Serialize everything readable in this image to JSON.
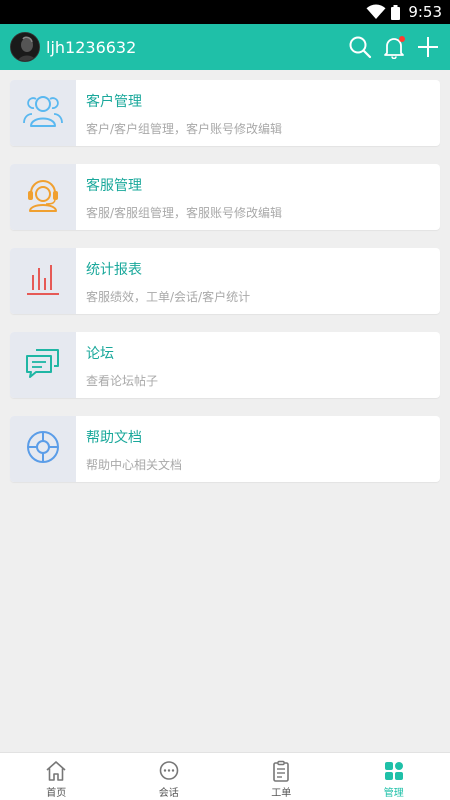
{
  "status_bar": {
    "time": "9:53"
  },
  "header": {
    "username": "ljh1236632"
  },
  "menu": [
    {
      "title": "客户管理",
      "desc": "客户/客户组管理，客户账号修改编辑",
      "icon": "users-icon"
    },
    {
      "title": "客服管理",
      "desc": "客服/客服组管理，客服账号修改编辑",
      "icon": "headset-agent-icon"
    },
    {
      "title": "统计报表",
      "desc": "客服绩效，工单/会话/客户统计",
      "icon": "bar-chart-icon"
    },
    {
      "title": "论坛",
      "desc": "查看论坛帖子",
      "icon": "chat-bubbles-icon"
    },
    {
      "title": "帮助文档",
      "desc": "帮助中心相关文档",
      "icon": "lifebuoy-icon"
    }
  ],
  "tabs": [
    {
      "label": "首页",
      "icon": "home-icon"
    },
    {
      "label": "会话",
      "icon": "chat-icon"
    },
    {
      "label": "工单",
      "icon": "clipboard-icon"
    },
    {
      "label": "管理",
      "icon": "grid-icon",
      "active": true
    }
  ],
  "colors": {
    "accent": "#1fc0a8",
    "title_text": "#1aa89b",
    "desc_text": "#a9a9a9",
    "background": "#efefef",
    "icon_tile": "#e6e9f0"
  }
}
